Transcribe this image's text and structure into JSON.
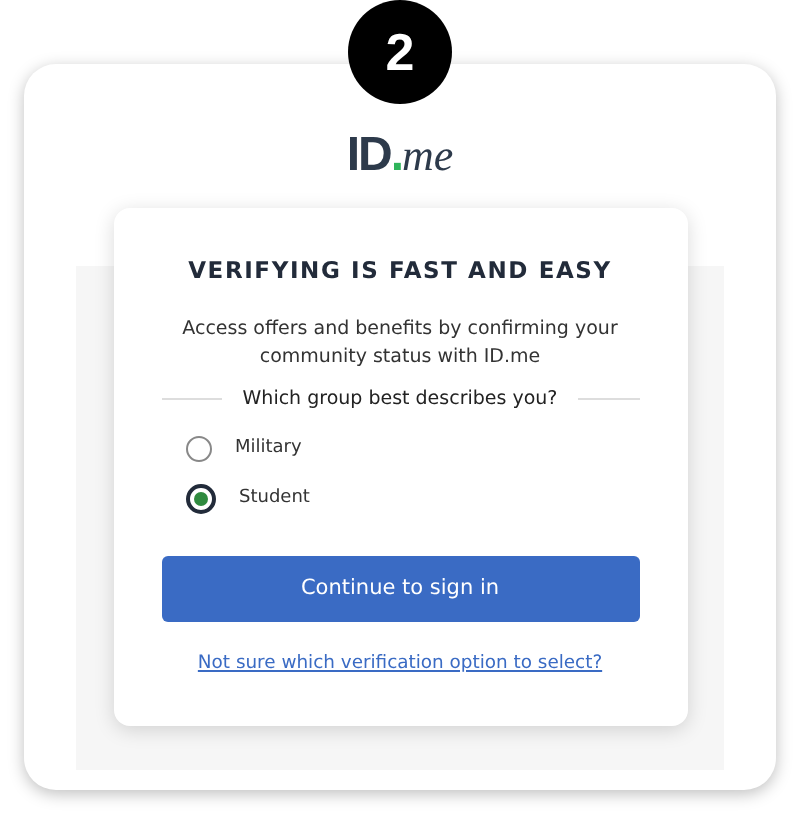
{
  "step_badge": "2",
  "logo": {
    "text": "ID",
    "accent": ".",
    "suffix": "me"
  },
  "card": {
    "title": "VERIFYING IS FAST AND EASY",
    "description": "Access offers and benefits by confirming your community status with ID.me",
    "question": "Which group best describes you?",
    "options": [
      {
        "label": "Military",
        "selected": false
      },
      {
        "label": "Student",
        "selected": true
      }
    ],
    "button": "Continue to sign in",
    "help_link": "Not sure which verification option to select?"
  }
}
